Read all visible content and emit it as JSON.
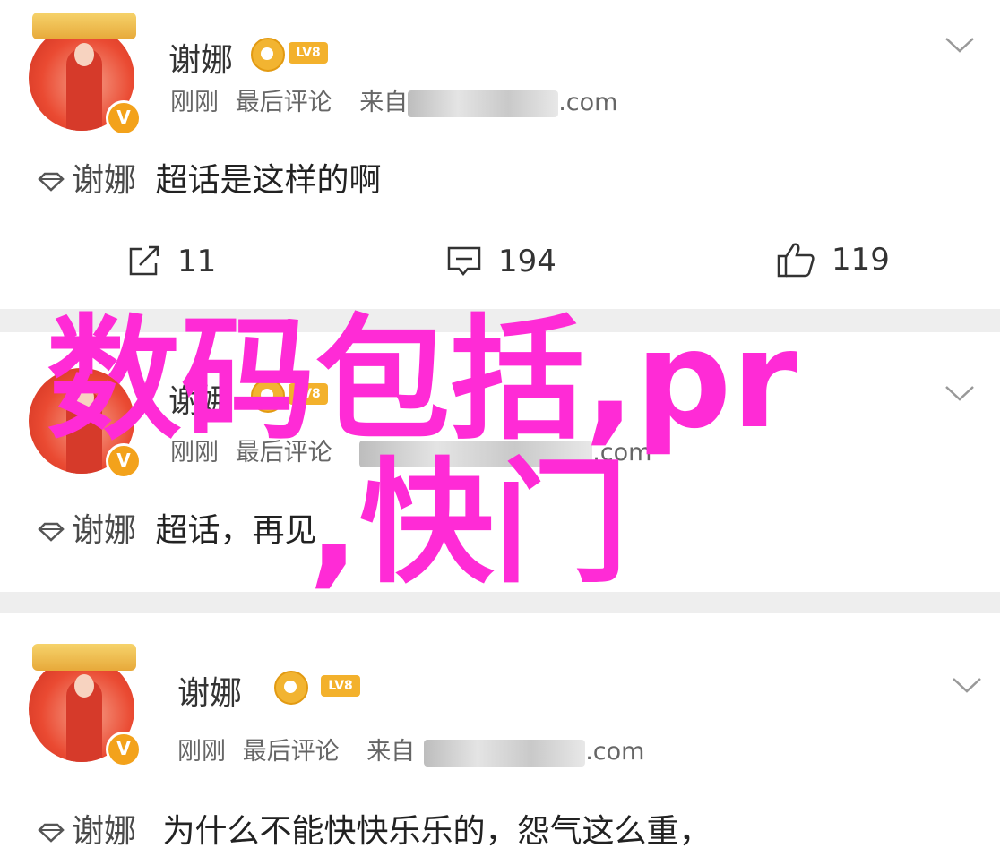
{
  "posts": [
    {
      "username": "谢娜",
      "level": "LV8",
      "avatar_badge": "V",
      "time": "刚刚",
      "action": "最后评论",
      "source_prefix": "来自",
      "source_suffix": ".com",
      "topic": "谢娜",
      "content": "超话是这样的啊",
      "stats": {
        "repost": "11",
        "comment": "194",
        "like": "119"
      }
    },
    {
      "username": "谢娜",
      "level": "LV8",
      "avatar_badge": "V",
      "time": "刚刚",
      "action": "最后评论",
      "source_suffix": ".com",
      "topic": "谢娜",
      "content": "超话，再见"
    },
    {
      "username": "谢娜",
      "level": "LV8",
      "avatar_badge": "V",
      "time": "刚刚",
      "action": "最后评论",
      "source_prefix": "来自",
      "source_suffix": ".com",
      "topic": "谢娜",
      "content": "为什么不能快快乐乐的，怨气这么重，"
    }
  ],
  "overlay": {
    "line1": "数码包括,pr",
    "line2": ",快门",
    "color": "#ff2bd6"
  },
  "icons": [
    "chevron-down-icon",
    "diamond-icon",
    "repost-icon",
    "comment-icon",
    "like-icon",
    "coin-icon"
  ]
}
